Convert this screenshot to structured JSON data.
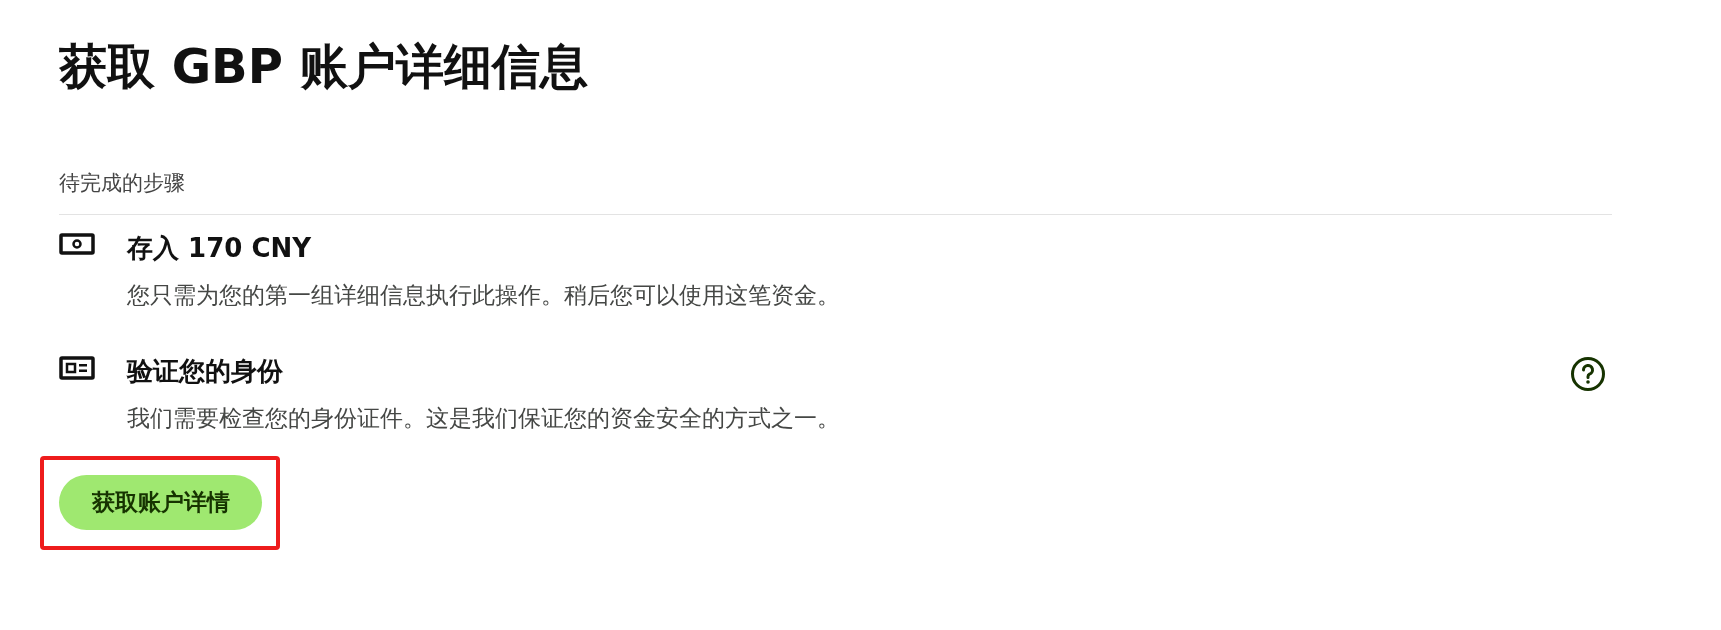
{
  "title": "获取 GBP 账户详细信息",
  "section_label": "待完成的步骤",
  "steps": [
    {
      "kind": "deposit",
      "title": "存入 170 CNY",
      "description": "您只需为您的第一组详细信息执行此操作。稍后您可以使用这笔资金。",
      "help": false
    },
    {
      "kind": "identity",
      "title": "验证您的身份",
      "description": "我们需要检查您的身份证件。这是我们保证您的资金安全的方式之一。",
      "help": true
    }
  ],
  "button": {
    "label": "获取账户详情",
    "highlighted": true
  }
}
